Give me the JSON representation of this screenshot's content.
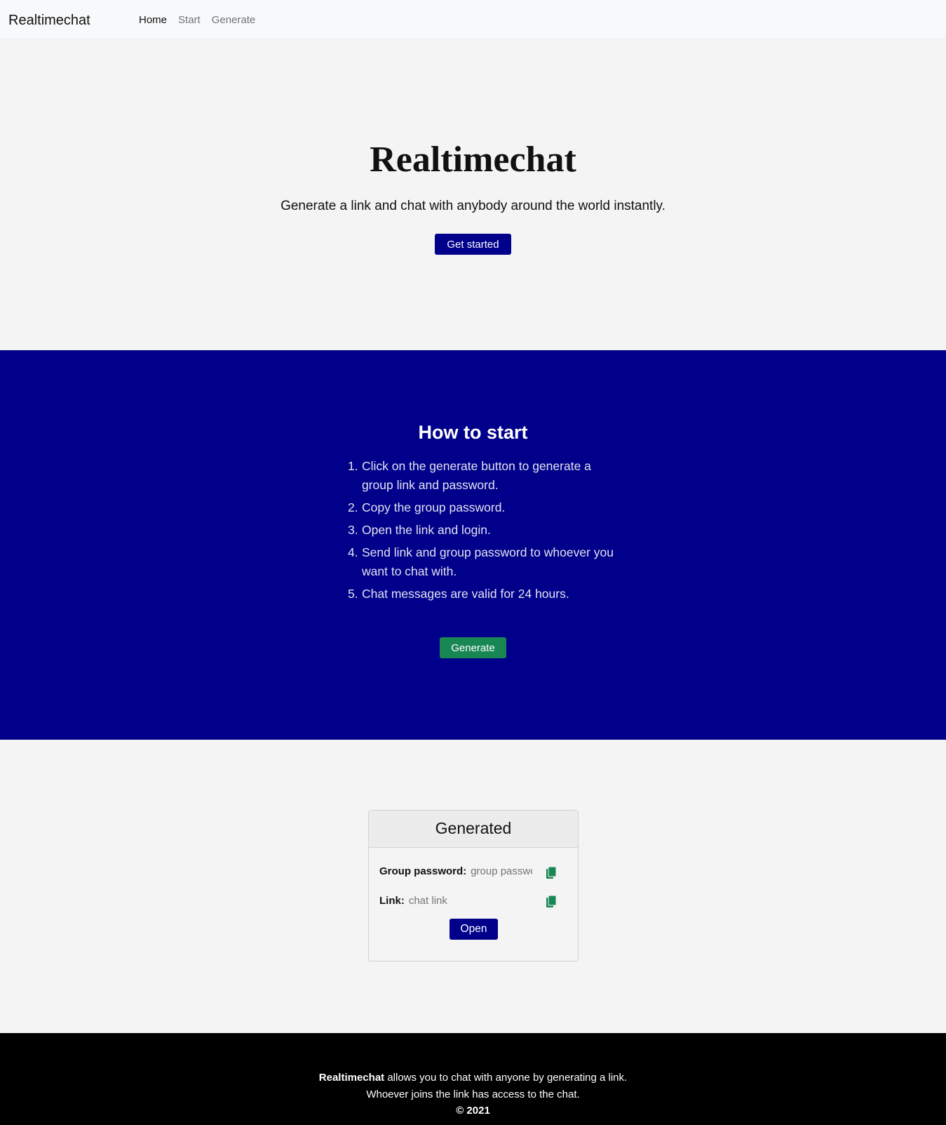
{
  "navbar": {
    "brand": "Realtimechat",
    "links": [
      {
        "label": "Home",
        "active": true
      },
      {
        "label": "Start",
        "active": false
      },
      {
        "label": "Generate",
        "active": false
      }
    ]
  },
  "hero": {
    "title": "Realtimechat",
    "subtitle": "Generate a link and chat with anybody around the world instantly.",
    "cta_label": "Get started"
  },
  "howto": {
    "title": "How to start",
    "steps": [
      {
        "num": "1.",
        "text": "Click on the generate button to generate a group link and password."
      },
      {
        "num": "2.",
        "text": "Copy the group password."
      },
      {
        "num": "3.",
        "text": "Open the link and login."
      },
      {
        "num": "4.",
        "text": "Send link and group password to whoever you want to chat with."
      },
      {
        "num": "5.",
        "text": "Chat messages are valid for 24 hours."
      }
    ],
    "generate_label": "Generate"
  },
  "generated": {
    "title": "Generated",
    "password_label": "Group password:",
    "password_placeholder": "group password",
    "link_label": "Link:",
    "link_placeholder": "chat link",
    "copy_icon": "clipboard-icon",
    "open_label": "Open"
  },
  "footer": {
    "brand": "Realtimechat",
    "line1_rest": " allows you to chat with anyone by generating a link.",
    "line2": "Whoever joins the link has access to the chat.",
    "copyright": "© 2021"
  },
  "colors": {
    "primary": "#00008b",
    "success": "#198754",
    "page_bg": "#f4f4f4",
    "footer_bg": "#000000"
  }
}
